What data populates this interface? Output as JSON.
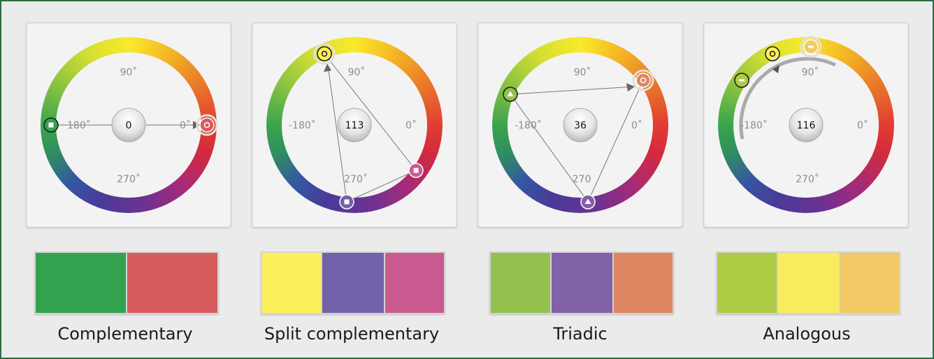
{
  "schemes": [
    {
      "id": "complementary",
      "name": "Complementary",
      "angle": "0",
      "degree_labels": {
        "deg_90": "90˚",
        "deg_180": "180˚",
        "deg_0": "0˚",
        "deg_270": "270˚"
      },
      "swatches": [
        "#34a350",
        "#d75c5e"
      ]
    },
    {
      "id": "split-complementary",
      "name": "Split complementary",
      "angle": "113",
      "degree_labels": {
        "deg_90": "90˚",
        "deg_180": "-180˚",
        "deg_0": "0˚",
        "deg_270": "270˚"
      },
      "swatches": [
        "#fbf05c",
        "#7262aa",
        "#cb5a90"
      ]
    },
    {
      "id": "triadic",
      "name": "Triadic",
      "angle": "36",
      "degree_labels": {
        "deg_90": "90˚",
        "deg_180": "-180˚",
        "deg_0": "0˚",
        "deg_270": "270"
      },
      "swatches": [
        "#93c14d",
        "#8161a7",
        "#de8662"
      ]
    },
    {
      "id": "analogous",
      "name": "Analogous",
      "angle": "116",
      "degree_labels": {
        "deg_90": "90˚",
        "deg_180": "-180˚",
        "deg_0": "0˚",
        "deg_270": "270˚"
      },
      "swatches": [
        "#adcb45",
        "#f9ed5e",
        "#f2c964"
      ]
    }
  ],
  "colors": {
    "frame_border": "#2f6b42",
    "swatch_border": "#d4d4d4"
  }
}
